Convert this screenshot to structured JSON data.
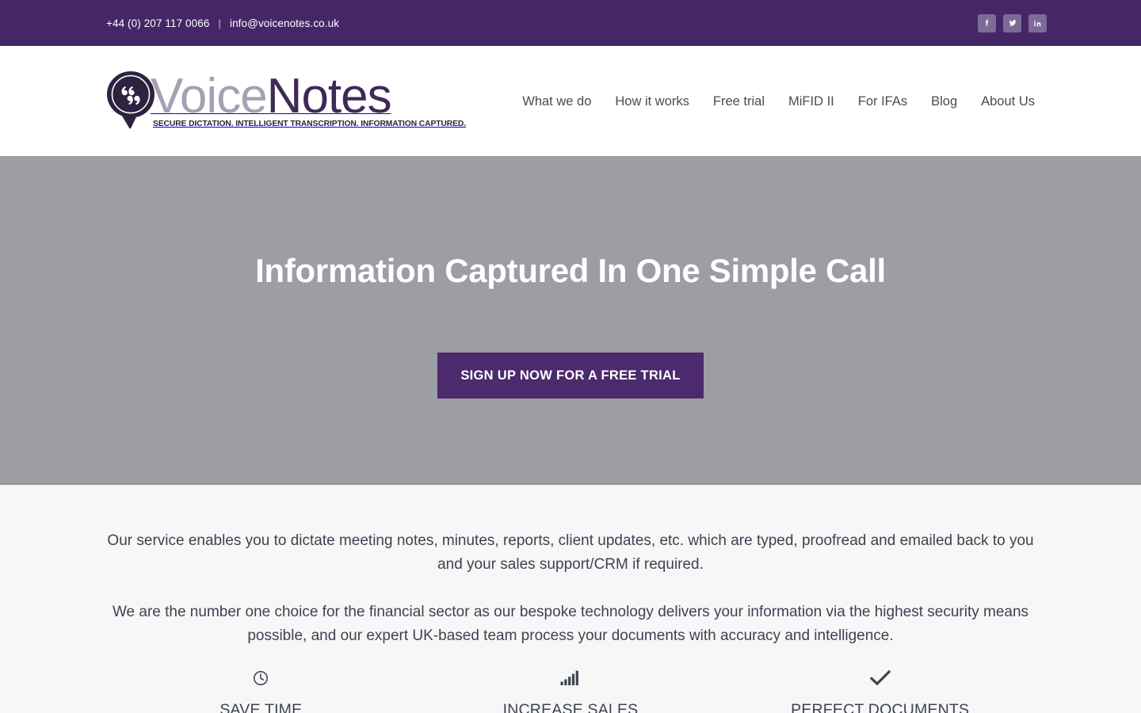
{
  "topbar": {
    "phone": "+44 (0) 207 117 0066",
    "separator": "|",
    "email": "info@voicenotes.co.uk",
    "background_color": "#452767",
    "social": [
      {
        "name": "facebook",
        "label": "Facebook",
        "glyph": "f"
      },
      {
        "name": "twitter",
        "label": "Twitter",
        "glyph": "t"
      },
      {
        "name": "linkedin",
        "label": "LinkedIn",
        "glyph": "in"
      }
    ],
    "social_button_color": "#7d6b96"
  },
  "header": {
    "logo": {
      "word_first": "Voice",
      "word_second": "Notes",
      "tagline": "SECURE DICTATION. INTELLIGENT TRANSCRIPTION. INFORMATION CAPTURED.",
      "mark_icon": "speech-bubble-quote-icon",
      "color_first": "#a79fb3",
      "color_second": "#3d2a55"
    },
    "nav": [
      {
        "name": "what-we-do",
        "label": "What we do"
      },
      {
        "name": "how-it-works",
        "label": "How it works"
      },
      {
        "name": "free-trial",
        "label": "Free trial"
      },
      {
        "name": "mifid-ii",
        "label": "MiFID II"
      },
      {
        "name": "for-ifas",
        "label": "For IFAs"
      },
      {
        "name": "blog",
        "label": "Blog"
      },
      {
        "name": "about-us",
        "label": "About Us"
      }
    ]
  },
  "hero": {
    "title": "Information Captured In One Simple Call",
    "cta_label": "SIGN UP NOW FOR A FREE TRIAL",
    "background_color": "#9c9ea3",
    "cta_color": "#4c2a6d"
  },
  "content": {
    "paragraph_one": "Our service enables you to dictate meeting notes, minutes, reports, client updates, etc. which are typed, proofread and emailed back to you and your sales support/CRM if required.",
    "paragraph_two": "We are the number one choice for the financial sector as our bespoke technology delivers your information via the highest security means possible, and our expert UK-based team process your documents with accuracy and intelligence.",
    "features": [
      {
        "name": "save-time",
        "label": "SAVE TIME",
        "icon": "clock-icon"
      },
      {
        "name": "increase-sales",
        "label": "INCREASE SALES",
        "icon": "bar-chart-icon"
      },
      {
        "name": "perfect-documents",
        "label": "PERFECT DOCUMENTS",
        "icon": "check-icon"
      }
    ]
  }
}
